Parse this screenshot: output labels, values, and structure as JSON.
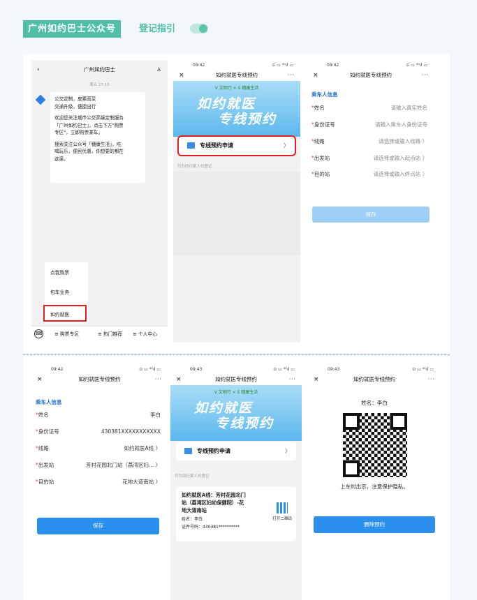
{
  "header": {
    "badge": "广州如约巴士公众号",
    "label": "登记指引"
  },
  "s1": {
    "title": "广州如约巴士",
    "time": "周五 17:15",
    "lines": [
      "公交定制，皮乘而至",
      "交通升级，便捷出行",
      "欢迎您关注城市公交高端定制服务",
      "「广州如约巴士」，点击下方\"购票",
      "专区\"，立即购票乘车。",
      "搜索关注公众号「穗康生活」，吃",
      "喝玩乐，便民优惠，你想要的都在",
      "这里。"
    ],
    "menu": [
      "点我购票",
      "包车业务",
      "如约就医"
    ],
    "tabs": [
      "≡ 购票专区",
      "≡ 热门推荐",
      "≡ 个人中心"
    ]
  },
  "status": {
    "t1": "09:42",
    "t2": "09:43",
    "icons": "⊙ ▭ ⁴ᴳıl ▭"
  },
  "navtitle": "如约就医专线预约",
  "close": "×",
  "more": "···",
  "banner": {
    "logo": "V 文明行 × S 穗康生活",
    "line1": "如约就医",
    "line2": "专线预约"
  },
  "apply": "专线预约申请",
  "hint": "可为同行家人代登记",
  "form": {
    "section": "乘车人信息",
    "labels": [
      "姓名",
      "身份证号",
      "线路",
      "出发站",
      "目的站"
    ],
    "placeholders": [
      "请输入真实姓名",
      "请输入乘车人身份证号",
      "请选择或输入线路 〉",
      "请选择或输入起点站 〉",
      "请选择或输入终点站 〉"
    ],
    "values": [
      "李白",
      "430381XXXXXXXXXXX",
      "如约就医A线 〉",
      "芳村花园北门站（荔湾区妇... 〉",
      "花地大道南站 〉"
    ],
    "save": "保存"
  },
  "ticket": {
    "line": "如约就医A线：芳村花园北门",
    "line2": "站（荔湾区妇幼保健院）-花",
    "line3": "地大道南站",
    "name": "姓名：李白",
    "id": "证件号码：430381**********",
    "qr": "打开二维码"
  },
  "qrpage": {
    "name": "姓名：李白",
    "note": "上车时出示，注意保护隐私。",
    "del": "删除预约"
  },
  "colors": {
    "accent": "#4fc0a6",
    "blue": "#2b8fee"
  }
}
